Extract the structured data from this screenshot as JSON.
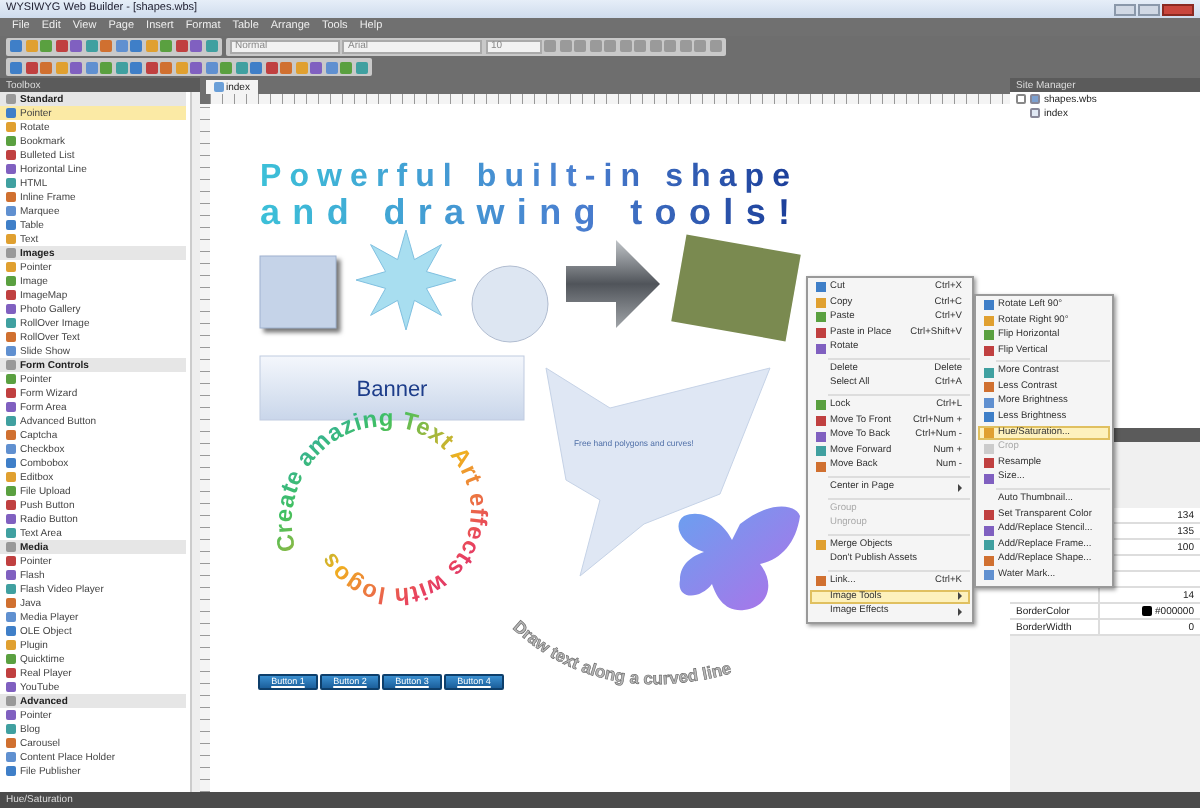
{
  "window": {
    "title": "WYSIWYG Web Builder - [shapes.wbs]"
  },
  "menu_bar": [
    "File",
    "Edit",
    "View",
    "Page",
    "Insert",
    "Format",
    "Table",
    "Arrange",
    "Tools",
    "Help"
  ],
  "toolbar": {
    "style": "Normal",
    "font": "Arial",
    "size": "10"
  },
  "toolbox": {
    "title": "Toolbox",
    "groups": [
      {
        "label": "Standard",
        "items": [
          {
            "label": "Pointer",
            "selected": true
          },
          {
            "label": "Rotate",
            "selected": false
          },
          {
            "label": "Bookmark",
            "selected": false
          },
          {
            "label": "Bulleted List",
            "selected": false
          },
          {
            "label": "Horizontal Line",
            "selected": false
          },
          {
            "label": "HTML",
            "selected": false
          },
          {
            "label": "Inline Frame",
            "selected": false
          },
          {
            "label": "Marquee",
            "selected": false
          },
          {
            "label": "Table",
            "selected": false
          },
          {
            "label": "Text",
            "selected": false
          }
        ]
      },
      {
        "label": "Images",
        "items": [
          {
            "label": "Pointer",
            "selected": false
          },
          {
            "label": "Image",
            "selected": false
          },
          {
            "label": "ImageMap",
            "selected": false
          },
          {
            "label": "Photo Gallery",
            "selected": false
          },
          {
            "label": "RollOver Image",
            "selected": false
          },
          {
            "label": "RollOver Text",
            "selected": false
          },
          {
            "label": "Slide Show",
            "selected": false
          }
        ]
      },
      {
        "label": "Form Controls",
        "items": [
          {
            "label": "Pointer",
            "selected": false
          },
          {
            "label": "Form Wizard",
            "selected": false
          },
          {
            "label": "Form Area",
            "selected": false
          },
          {
            "label": "Advanced Button",
            "selected": false
          },
          {
            "label": "Captcha",
            "selected": false
          },
          {
            "label": "Checkbox",
            "selected": false
          },
          {
            "label": "Combobox",
            "selected": false
          },
          {
            "label": "Editbox",
            "selected": false
          },
          {
            "label": "File Upload",
            "selected": false
          },
          {
            "label": "Push Button",
            "selected": false
          },
          {
            "label": "Radio Button",
            "selected": false
          },
          {
            "label": "Text Area",
            "selected": false
          }
        ]
      },
      {
        "label": "Media",
        "items": [
          {
            "label": "Pointer",
            "selected": false
          },
          {
            "label": "Flash",
            "selected": false
          },
          {
            "label": "Flash Video Player",
            "selected": false
          },
          {
            "label": "Java",
            "selected": false
          },
          {
            "label": "Media Player",
            "selected": false
          },
          {
            "label": "OLE Object",
            "selected": false
          },
          {
            "label": "Plugin",
            "selected": false
          },
          {
            "label": "Quicktime",
            "selected": false
          },
          {
            "label": "Real Player",
            "selected": false
          },
          {
            "label": "YouTube",
            "selected": false
          }
        ]
      },
      {
        "label": "Advanced",
        "items": [
          {
            "label": "Pointer",
            "selected": false
          },
          {
            "label": "Blog",
            "selected": false
          },
          {
            "label": "Carousel",
            "selected": false
          },
          {
            "label": "Content Place Holder",
            "selected": false
          },
          {
            "label": "File Publisher",
            "selected": false
          }
        ]
      }
    ]
  },
  "document_tab": {
    "label": "index"
  },
  "canvas": {
    "heading": [
      "Powerful built-in shape",
      "and drawing tools!"
    ],
    "banner": "Banner",
    "polygon_text": "Free hand polygons and curves!",
    "circular_text": "Create amazing Text Art effects with logos",
    "curved_text": "Draw text along a curved line",
    "buttons": [
      "Button 1",
      "Button 2",
      "Button 3",
      "Button 4"
    ]
  },
  "site_manager": {
    "title": "Site Manager",
    "tree": [
      {
        "label": "shapes.wbs",
        "expanded": true,
        "children": [
          {
            "label": "index"
          }
        ]
      }
    ]
  },
  "properties": {
    "rows": [
      {
        "value": "134"
      },
      {
        "value": "135"
      },
      {
        "value": "100"
      },
      {
        "value": "14"
      },
      {
        "name": "BorderColor",
        "value": "#000000",
        "color": "#000000"
      },
      {
        "name": "BorderWidth",
        "value": "0"
      }
    ]
  },
  "context_menu": {
    "sections": [
      [
        {
          "label": "Cut",
          "shortcut": "Ctrl+X",
          "icon": true,
          "submenu": false,
          "disabled": false,
          "selected": false
        },
        {
          "label": "Copy",
          "shortcut": "Ctrl+C",
          "icon": true,
          "submenu": false,
          "disabled": false,
          "selected": false
        },
        {
          "label": "Paste",
          "shortcut": "Ctrl+V",
          "icon": true,
          "submenu": false,
          "disabled": false,
          "selected": false
        },
        {
          "label": "Paste in Place",
          "shortcut": "Ctrl+Shift+V",
          "icon": true,
          "submenu": false,
          "disabled": false,
          "selected": false
        },
        {
          "label": "Rotate",
          "icon": true,
          "submenu": false,
          "disabled": false,
          "selected": false
        }
      ],
      [
        {
          "label": "Delete",
          "shortcut": "Delete",
          "icon": false,
          "submenu": false,
          "disabled": false,
          "selected": false
        },
        {
          "label": "Select All",
          "shortcut": "Ctrl+A",
          "icon": false,
          "submenu": false,
          "disabled": false,
          "selected": false
        }
      ],
      [
        {
          "label": "Lock",
          "shortcut": "Ctrl+L",
          "icon": true,
          "submenu": false,
          "disabled": false,
          "selected": false
        },
        {
          "label": "Move To Front",
          "shortcut": "Ctrl+Num +",
          "icon": true,
          "submenu": false,
          "disabled": false,
          "selected": false
        },
        {
          "label": "Move To Back",
          "shortcut": "Ctrl+Num -",
          "icon": true,
          "submenu": false,
          "disabled": false,
          "selected": false
        },
        {
          "label": "Move Forward",
          "shortcut": "Num +",
          "icon": true,
          "submenu": false,
          "disabled": false,
          "selected": false
        },
        {
          "label": "Move Back",
          "shortcut": "Num -",
          "icon": true,
          "submenu": false,
          "disabled": false,
          "selected": false
        }
      ],
      [
        {
          "label": "Center in Page",
          "icon": false,
          "submenu": true,
          "disabled": false,
          "selected": false
        }
      ],
      [
        {
          "label": "Group",
          "icon": false,
          "submenu": false,
          "disabled": true,
          "selected": false
        },
        {
          "label": "Ungroup",
          "icon": false,
          "submenu": false,
          "disabled": true,
          "selected": false
        }
      ],
      [
        {
          "label": "Merge Objects",
          "icon": true,
          "submenu": false,
          "disabled": false,
          "selected": false
        },
        {
          "label": "Don't Publish Assets",
          "icon": false,
          "submenu": false,
          "disabled": false,
          "selected": false
        }
      ],
      [
        {
          "label": "Link...",
          "shortcut": "Ctrl+K",
          "icon": true,
          "submenu": false,
          "disabled": false,
          "selected": false
        },
        {
          "label": "Image Tools",
          "icon": false,
          "submenu": true,
          "disabled": false,
          "selected": true
        },
        {
          "label": "Image Effects",
          "icon": false,
          "submenu": true,
          "disabled": false,
          "selected": false
        }
      ]
    ]
  },
  "submenu": {
    "sections": [
      [
        {
          "label": "Rotate Left 90°",
          "icon": true,
          "disabled": false,
          "selected": false
        },
        {
          "label": "Rotate Right 90°",
          "icon": true,
          "disabled": false,
          "selected": false
        },
        {
          "label": "Flip Horizontal",
          "icon": true,
          "disabled": false,
          "selected": false
        },
        {
          "label": "Flip Vertical",
          "icon": true,
          "disabled": false,
          "selected": false
        }
      ],
      [
        {
          "label": "More Contrast",
          "icon": true,
          "disabled": false,
          "selected": false
        },
        {
          "label": "Less Contrast",
          "icon": true,
          "disabled": false,
          "selected": false
        },
        {
          "label": "More Brightness",
          "icon": true,
          "disabled": false,
          "selected": false
        },
        {
          "label": "Less Brightness",
          "icon": true,
          "disabled": false,
          "selected": false
        },
        {
          "label": "Hue/Saturation...",
          "icon": true,
          "disabled": false,
          "selected": true
        },
        {
          "label": "Crop",
          "icon": true,
          "disabled": true,
          "selected": false
        },
        {
          "label": "Resample",
          "icon": true,
          "disabled": false,
          "selected": false
        },
        {
          "label": "Size...",
          "icon": true,
          "disabled": false,
          "selected": false
        }
      ],
      [
        {
          "label": "Auto Thumbnail...",
          "icon": false,
          "disabled": false,
          "selected": false
        },
        {
          "label": "Set Transparent Color",
          "icon": true,
          "disabled": false,
          "selected": false
        },
        {
          "label": "Add/Replace Stencil...",
          "icon": true,
          "disabled": false,
          "selected": false
        },
        {
          "label": "Add/Replace Frame...",
          "icon": true,
          "disabled": false,
          "selected": false
        },
        {
          "label": "Add/Replace Shape...",
          "icon": true,
          "disabled": false,
          "selected": false
        },
        {
          "label": "Water Mark...",
          "icon": true,
          "disabled": false,
          "selected": false
        }
      ]
    ]
  },
  "status_bar": "Hue/Saturation"
}
